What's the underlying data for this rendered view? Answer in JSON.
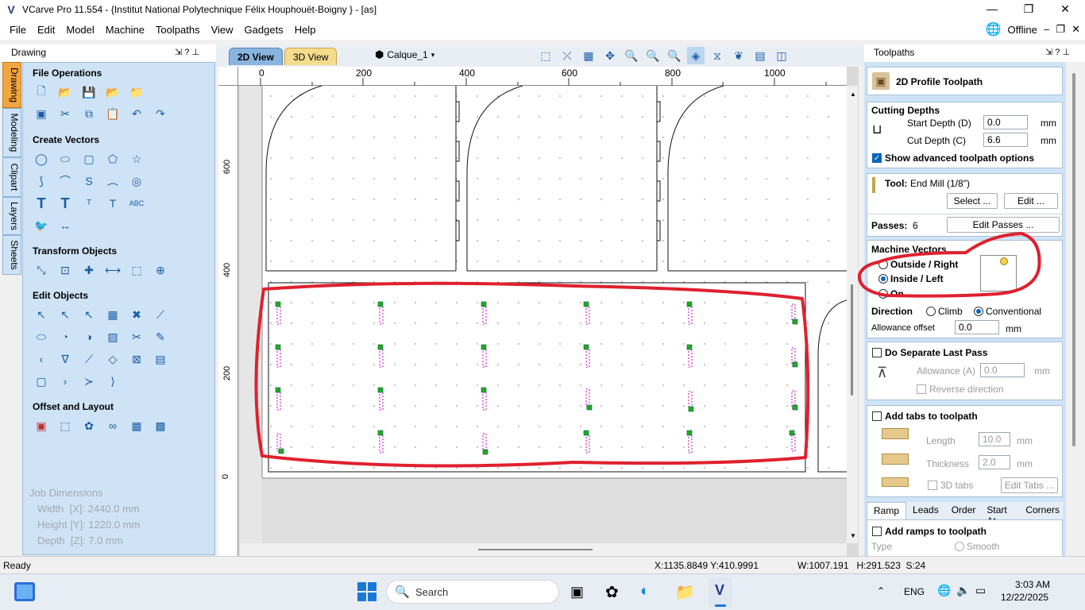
{
  "window": {
    "title": "VCarve Pro 11.554 - {Institut National Polytechnique Félix Houphouët-Boigny } - [as]",
    "logo": "V"
  },
  "menu": [
    "File",
    "Edit",
    "Model",
    "Machine",
    "Toolpaths",
    "View",
    "Gadgets",
    "Help"
  ],
  "offline_label": "Offline",
  "left_panel": {
    "header": "Drawing",
    "tabs": [
      "Drawing",
      "Modeling",
      "Clipart",
      "Layers",
      "Sheets"
    ],
    "sections": {
      "file_operations": "File Operations",
      "create_vectors": "Create Vectors",
      "transform_objects": "Transform Objects",
      "edit_objects": "Edit Objects",
      "offset_layout": "Offset and Layout"
    },
    "job": {
      "title": "Job Dimensions",
      "width": "Width  [X]: 2440.0 mm",
      "height": "Height [Y]: 1220.0 mm",
      "depth": "Depth  [Z]: 7.0 mm"
    }
  },
  "view_tabs": {
    "tab2d": "2D View",
    "tab3d": "3D View",
    "layer": "Calque_1"
  },
  "rulers": {
    "h_ticks": [
      "0",
      "200",
      "400",
      "600",
      "800",
      "1000"
    ],
    "v_ticks": [
      "600",
      "400",
      "200",
      "0"
    ]
  },
  "right_panel": {
    "header": "Toolpaths",
    "title": "2D Profile Toolpath",
    "cutting_depths": {
      "title": "Cutting Depths",
      "start_label": "Start Depth (D)",
      "start_value": "0.0",
      "cut_label": "Cut Depth (C)",
      "cut_value": "6.6",
      "unit": "mm"
    },
    "advanced_label": "Show advanced toolpath options",
    "tool": {
      "label": "Tool:",
      "name": "End Mill (1/8\")",
      "select": "Select ...",
      "edit": "Edit ..."
    },
    "passes": {
      "label": "Passes:",
      "value": "6",
      "edit": "Edit Passes ..."
    },
    "machine_vectors": {
      "title": "Machine Vectors...",
      "outside": "Outside / Right",
      "inside": "Inside / Left",
      "on": "On",
      "direction": "Direction",
      "climb": "Climb",
      "conventional": "Conventional",
      "allowance_label": "Allowance offset",
      "allowance_value": "0.0",
      "unit": "mm"
    },
    "last_pass": {
      "title": "Do Separate Last Pass",
      "allowance_label": "Allowance (A)",
      "allowance_value": "0.0",
      "unit": "mm",
      "reverse": "Reverse direction"
    },
    "tabs": {
      "title": "Add tabs to toolpath",
      "length_label": "Length",
      "length_value": "10.0",
      "thickness_label": "Thickness",
      "thickness_value": "2.0",
      "unit": "mm",
      "tabs3d": "3D tabs",
      "edit": "Edit Tabs ..."
    },
    "bottom_tabs": [
      "Ramp",
      "Leads",
      "Order",
      "Start At",
      "Corners"
    ],
    "ramps": {
      "title": "Add ramps to toolpath",
      "type": "Type",
      "smooth": "Smooth"
    }
  },
  "status": {
    "ready": "Ready",
    "coords": "X:1135.8849 Y:410.9991",
    "dims": "W:1007.191   H:291.523  S:24"
  },
  "taskbar": {
    "search": "Search",
    "lang": "ENG",
    "time": "3:03 AM",
    "date": "12/22/2025"
  },
  "colors": {
    "accent": "#0067c0",
    "annotation": "#e0202e",
    "panel": "#cfe3f6",
    "active_tab": "#f2a640"
  }
}
